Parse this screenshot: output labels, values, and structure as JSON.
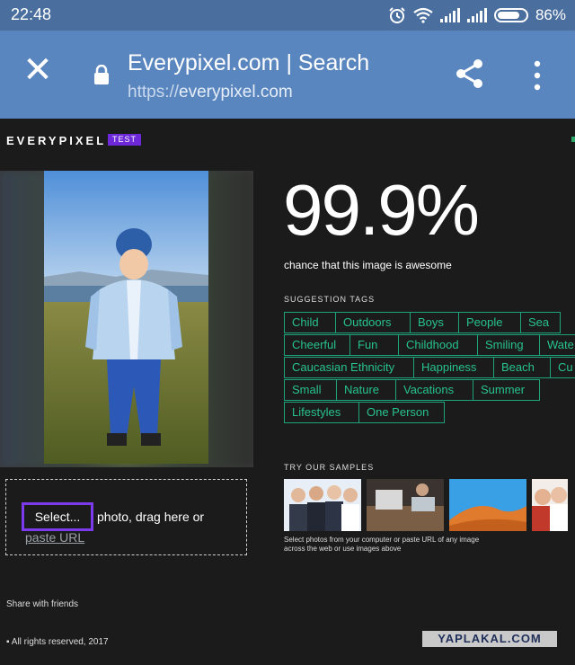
{
  "status_bar": {
    "time": "22:48",
    "battery": "86%",
    "icons": [
      "alarm-icon",
      "wifi-icon",
      "signal-icon",
      "signal-icon",
      "battery-icon"
    ]
  },
  "browser": {
    "title": "Everypixel.com | Search",
    "url_scheme": "https://",
    "url_host": "everypixel.com",
    "icons": [
      "close-icon",
      "lock-icon",
      "share-icon",
      "more-vert-icon"
    ]
  },
  "page": {
    "logo": "EVERYPIXEL",
    "badge": "TEST",
    "score": "99.9%",
    "score_caption": "chance that this image is awesome",
    "tags_heading": "SUGGESTION TAGS",
    "tags": [
      "Child",
      "Outdoors",
      "Boys",
      "People",
      "Sea",
      "Cheerful",
      "Fun",
      "Childhood",
      "Smiling",
      "Wate",
      "Caucasian Ethnicity",
      "Happiness",
      "Beach",
      "Cu",
      "Small",
      "Nature",
      "Vacations",
      "Summer",
      "Lifestyles",
      "One Person"
    ],
    "upload": {
      "select_label": "Select...",
      "drop_text": "photo, drag here or",
      "paste_url": "paste URL"
    },
    "samples_heading": "TRY OUR SAMPLES",
    "samples_note": "Select photos from your computer or paste URL of any image across the web or use images above",
    "share_friends": "Share with friends",
    "rights": "All rights reserved, 2017",
    "watermark": "YAPLAKAL.COM"
  },
  "colors": {
    "status_bar": "#4a6f9f",
    "browser_bar": "#5a86bf",
    "page_bg": "#1b1b1b",
    "tag_border": "#1fa37a",
    "tag_text": "#27c28d",
    "accent": "#7c3aed"
  }
}
